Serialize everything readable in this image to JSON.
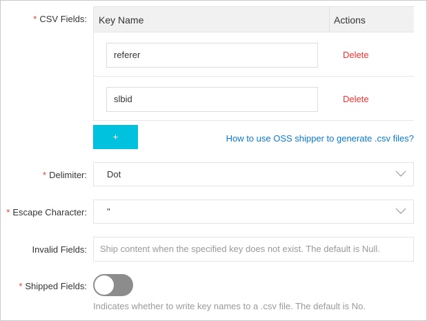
{
  "csv_fields": {
    "label": "CSV Fields:",
    "columns": [
      "Key Name",
      "Actions"
    ],
    "rows": [
      {
        "key": "referer",
        "action": "Delete"
      },
      {
        "key": "slbid",
        "action": "Delete"
      }
    ],
    "add_label": "+",
    "help_link": "How to use OSS shipper to generate .csv files?"
  },
  "delimiter": {
    "label": "Delimiter:",
    "value": "Dot"
  },
  "escape": {
    "label": "Escape Character:",
    "value": "\""
  },
  "invalid": {
    "label": "Invalid Fields:",
    "placeholder": "Ship content when the specified key does not exist. The default is Null."
  },
  "shipped": {
    "label": "Shipped Fields:",
    "enabled": false,
    "hint": "Indicates whether to write key names to a .csv file. The default is No."
  },
  "required_mark": "*",
  "colors": {
    "accent": "#00c1de",
    "link": "#0a79d6",
    "danger": "#ff2d2d"
  }
}
